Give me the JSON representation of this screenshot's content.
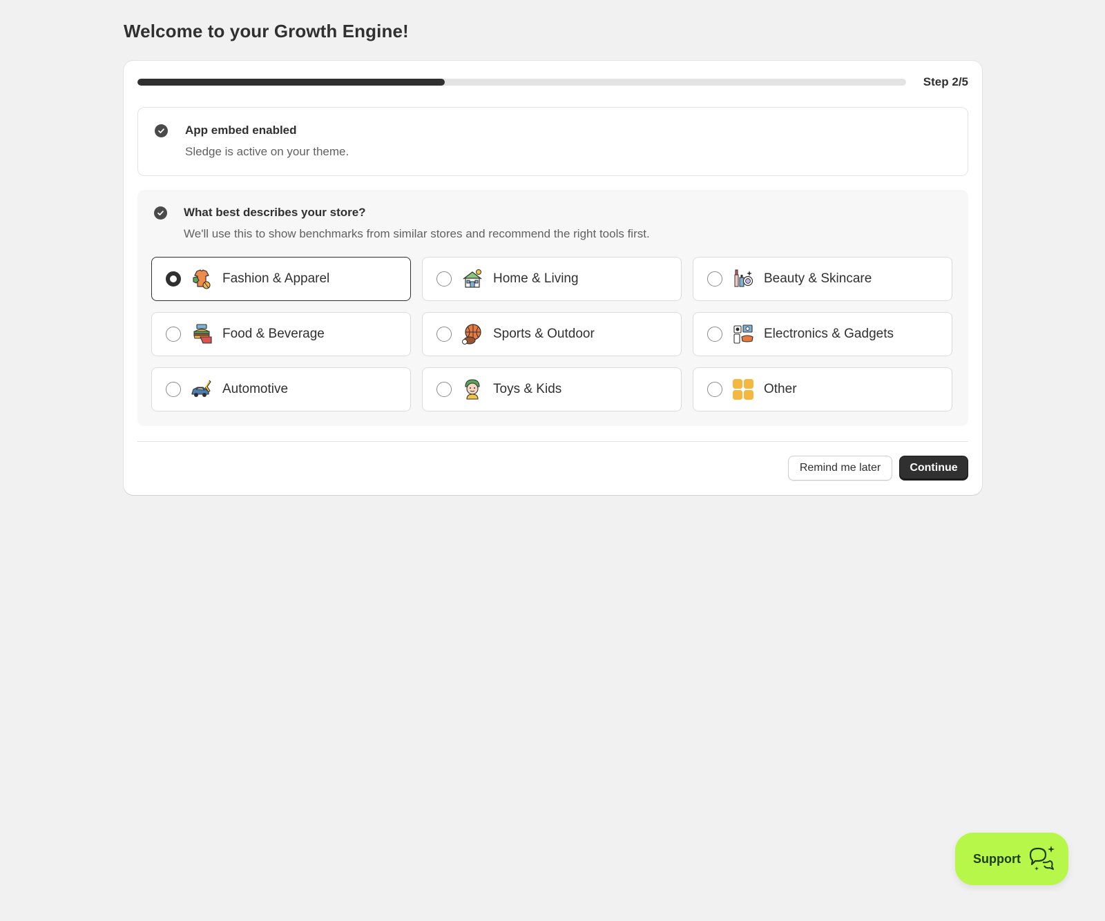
{
  "page": {
    "title": "Welcome to your Growth Engine!"
  },
  "progress": {
    "fraction": 0.4,
    "step_label": "Step 2/5",
    "fill_color": "#303030",
    "track_color": "#e3e3e3"
  },
  "step_done": {
    "title": "App embed enabled",
    "description": "Sledge is active on your theme.",
    "icon": "check-circle-icon"
  },
  "step_active": {
    "title": "What best describes your store?",
    "description": "We'll use this to show benchmarks from similar stores and recommend the right tools first.",
    "icon": "check-circle-icon",
    "options": [
      {
        "label": "Fashion & Apparel",
        "icon": "clothes-icon",
        "selected": true
      },
      {
        "label": "Home & Living",
        "icon": "house-icon",
        "selected": false
      },
      {
        "label": "Beauty & Skincare",
        "icon": "cosmetics-icon",
        "selected": false
      },
      {
        "label": "Food & Beverage",
        "icon": "food-icon",
        "selected": false
      },
      {
        "label": "Sports & Outdoor",
        "icon": "ball-icon",
        "selected": false
      },
      {
        "label": "Electronics & Gadgets",
        "icon": "devices-icon",
        "selected": false
      },
      {
        "label": "Automotive",
        "icon": "car-icon",
        "selected": false
      },
      {
        "label": "Toys & Kids",
        "icon": "kid-icon",
        "selected": false
      },
      {
        "label": "Other",
        "icon": "grid-icon",
        "selected": false
      }
    ]
  },
  "footer": {
    "remind_label": "Remind me later",
    "continue_label": "Continue"
  },
  "support": {
    "label": "Support",
    "icon": "chat-sparkle-icon",
    "color": "#b7f74a"
  }
}
